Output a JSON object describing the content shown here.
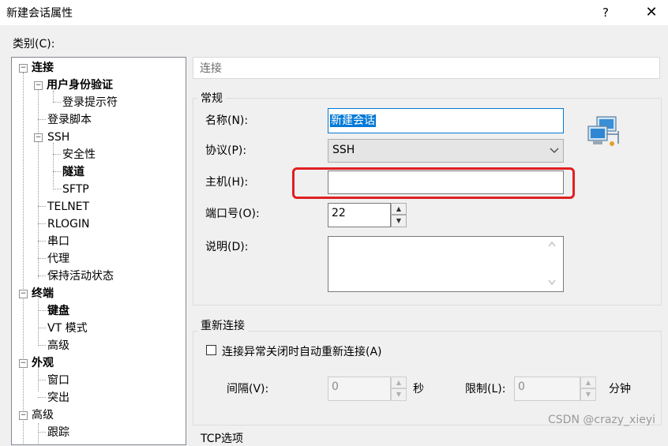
{
  "window": {
    "title": "新建会话属性",
    "help_label": "?",
    "close_label": "✕"
  },
  "category_label": "类别(C):",
  "tree": {
    "items": [
      {
        "label": "连接"
      },
      {
        "label": "用户身份验证"
      },
      {
        "label": "登录提示符"
      },
      {
        "label": "登录脚本"
      },
      {
        "label": "SSH"
      },
      {
        "label": "安全性"
      },
      {
        "label": "隧道"
      },
      {
        "label": "SFTP"
      },
      {
        "label": "TELNET"
      },
      {
        "label": "RLOGIN"
      },
      {
        "label": "串口"
      },
      {
        "label": "代理"
      },
      {
        "label": "保持活动状态"
      },
      {
        "label": "终端"
      },
      {
        "label": "键盘"
      },
      {
        "label": "VT 模式"
      },
      {
        "label": "高级"
      },
      {
        "label": "外观"
      },
      {
        "label": "窗口"
      },
      {
        "label": "突出"
      },
      {
        "label": "高级"
      },
      {
        "label": "跟踪"
      }
    ]
  },
  "section_header": "连接",
  "general": {
    "title": "常规",
    "name_label": "名称(N):",
    "name_value": "新建会话",
    "protocol_label": "协议(P):",
    "protocol_value": "SSH",
    "host_label": "主机(H):",
    "host_value": "",
    "port_label": "端口号(O):",
    "port_value": "22",
    "desc_label": "说明(D):",
    "desc_value": ""
  },
  "reconnect": {
    "title": "重新连接",
    "checkbox_label": "连接异常关闭时自动重新连接(A)",
    "interval_label": "间隔(V):",
    "interval_value": "0",
    "interval_unit": "秒",
    "limit_label": "限制(L):",
    "limit_value": "0",
    "limit_unit": "分钟"
  },
  "tcp_group_title": "TCP选项",
  "watermark": "CSDN @crazy_xieyi",
  "icons": {
    "network": "network-computers-icon",
    "dropdown": "chevron-down-icon"
  },
  "colors": {
    "highlight": "#0078d7",
    "annotation": "#e02020"
  }
}
